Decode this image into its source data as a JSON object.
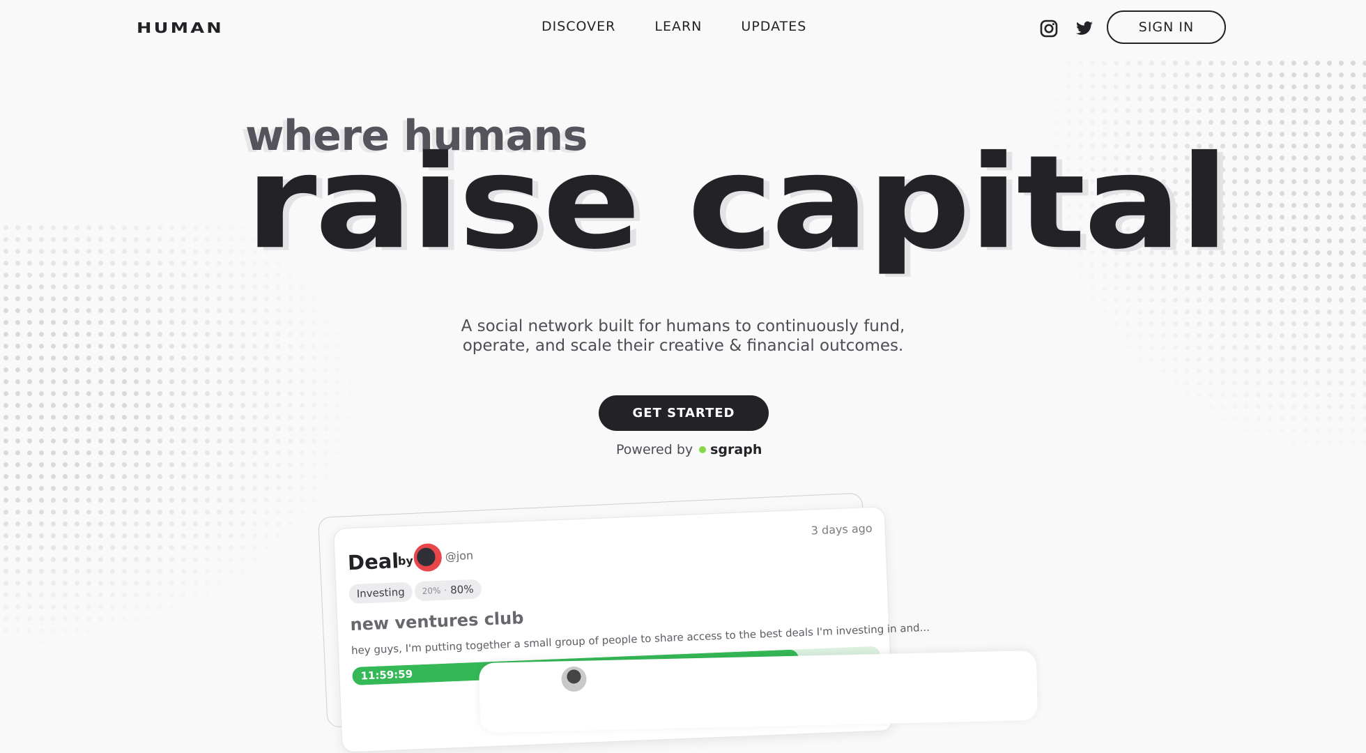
{
  "nav": {
    "brand": "HUMAN",
    "links": [
      "DISCOVER",
      "LEARN",
      "UPDATES"
    ],
    "signin_label": "SIGN IN",
    "icons": [
      "instagram-icon",
      "twitter-icon"
    ]
  },
  "hero": {
    "subtitle": "where humans",
    "title": "raise capital",
    "tagline_line1": "A social network built for humans to continuously fund,",
    "tagline_line2": "operate, and scale their creative & financial outcomes.",
    "cta_label": "GET STARTED",
    "powered_by": "Powered by",
    "powered_brand": "sgraph"
  },
  "deal_card": {
    "title": "Deal",
    "by": "by",
    "handle": "@jon",
    "time_ago": "3 days ago",
    "tag": "Investing",
    "percent_small": "20%",
    "percent_sep": "·",
    "percent_main": "80%",
    "name": "new ventures club",
    "message": "hey guys, I'm putting together a small group of people to share access to the best deals I'm investing in and...",
    "timer": "11:59:59",
    "progress": 0.845
  },
  "colors": {
    "background": "#f9f9f9",
    "text_dark": "#232327",
    "accent_green": "#35b957",
    "powered_dot": "#84d84a",
    "avatar_ring": "#e9464c"
  }
}
